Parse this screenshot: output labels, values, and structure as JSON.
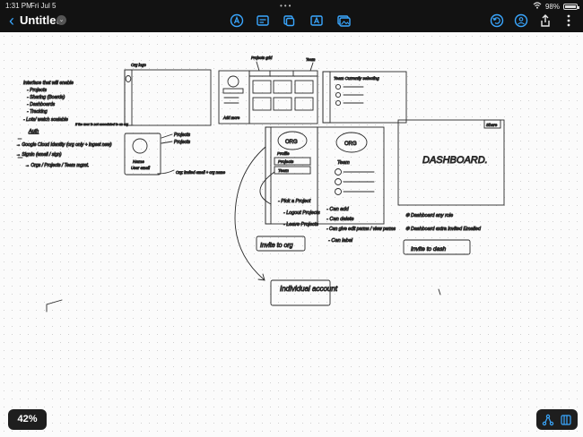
{
  "status": {
    "time": "1:31 PM",
    "date": "Fri Jul 5",
    "battery": "98%"
  },
  "document": {
    "title": "Untitled"
  },
  "colors": {
    "accent": "#3aa7ff",
    "chrome": "#121212",
    "ink": "#222222"
  },
  "toolbar": {
    "left": [
      "back-icon",
      "title-menu-chevron-icon"
    ],
    "center": [
      "pen-tool-icon",
      "shapes-icon",
      "sticky-note-icon",
      "text-box-icon",
      "image-icon"
    ],
    "right": [
      "undo-icon",
      "collaborate-icon",
      "share-icon",
      "more-icon"
    ]
  },
  "zoom": {
    "label": "42%"
  },
  "bottom_tools": [
    "connect-icon",
    "library-icon"
  ],
  "sketch": {
    "notes_left": {
      "lines": [
        "Interface that will enable",
        "- Projects",
        "- Sharing (Boards)",
        "- Dashboards",
        "- Tracking",
        "- Lots/ watch scalable"
      ]
    },
    "notes_flow": {
      "header": "Auth",
      "lines": [
        "→ Google Cloud Identity (org only + ingest new)",
        "→ SignIn (email / sign)",
        "→ Orgs / Projects / Team mgmt."
      ],
      "aside": "If the user is not associated to an org"
    },
    "profile_card": {
      "name": "Name",
      "email": "User email",
      "arrows": [
        "Projects",
        "Projects"
      ],
      "footer": "Org: invited email + org name"
    },
    "wf_org_label": "Org logo",
    "wf_projects": {
      "label": "Projects grid",
      "column_label": "Team",
      "sidebar_label": "Add more"
    },
    "wf_team": {
      "title": "Team Currently selecting"
    },
    "wf_org_card": {
      "title": "ORG",
      "lines": [
        "Profile",
        "Projects",
        "Team"
      ],
      "notes": [
        "- Pick a Project",
        "- Logout Projects",
        "- Leave Projects"
      ],
      "button": "Invite to org"
    },
    "wf_team_card": {
      "title": "ORG",
      "label": "Team",
      "notes": [
        "- Can add",
        "- Can delete",
        "- Can give edit perms / view perms",
        "- Can label"
      ]
    },
    "wf_dashboard": {
      "title": "DASHBOARD.",
      "corner": "Share",
      "notes": [
        "✱ Dashboard any role",
        "✱ Dashboard extra invited Emailed"
      ],
      "button": "Invite to dash"
    },
    "individual_box": "Individual account"
  }
}
